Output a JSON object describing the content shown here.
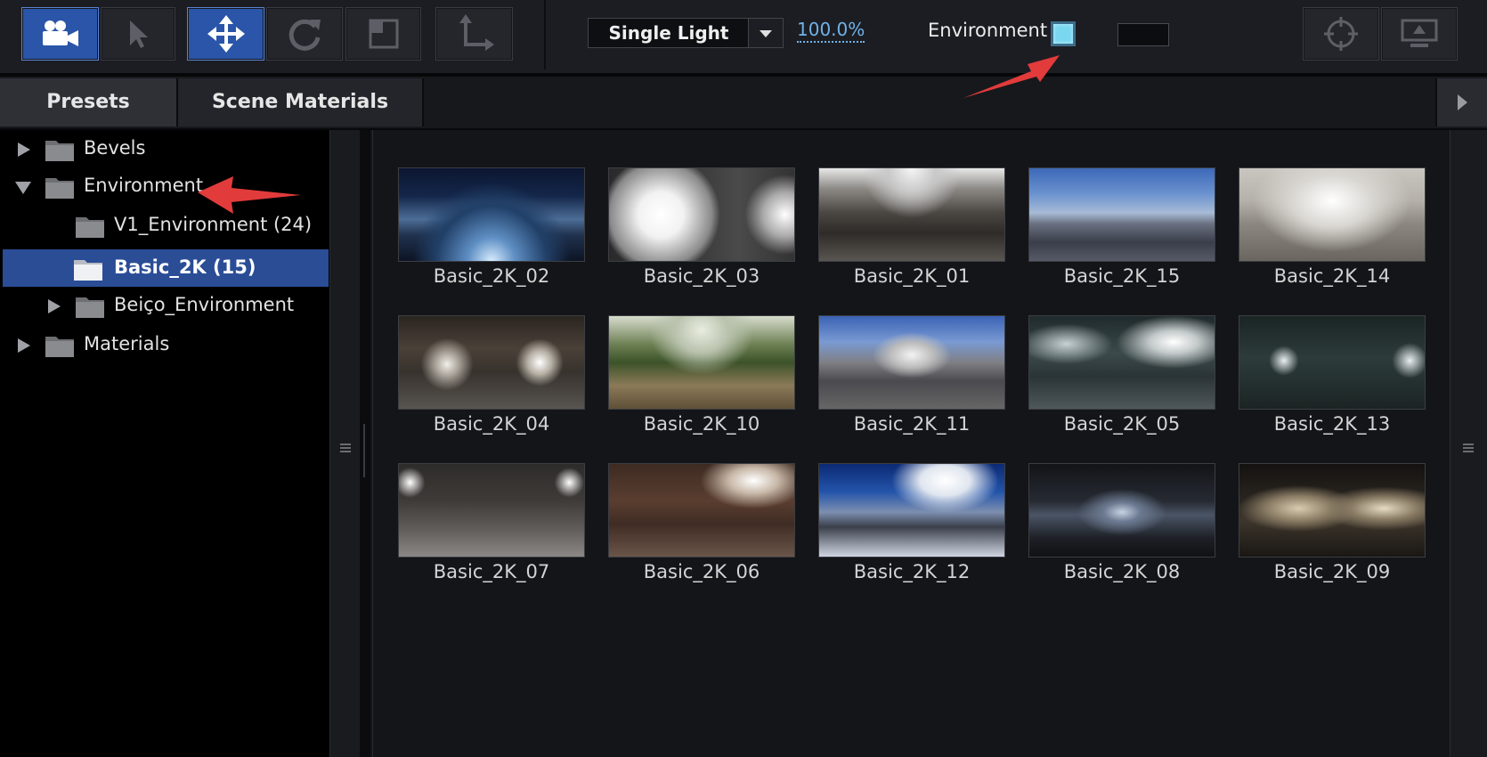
{
  "toolbar": {
    "tools": [
      {
        "name": "camera-tool-button",
        "icon": "video-camera-icon",
        "active": true
      },
      {
        "name": "select-tool-button",
        "icon": "pointer-arrow-icon",
        "active": false
      },
      {
        "name": "move-tool-button",
        "icon": "move-arrows-icon",
        "active": true
      },
      {
        "name": "rotate-tool-button",
        "icon": "rotate-icon",
        "active": false
      },
      {
        "name": "scale-tool-button",
        "icon": "scale-box-icon",
        "active": false
      },
      {
        "name": "axis-tool-button",
        "icon": "axis-arrows-icon",
        "active": false
      }
    ],
    "lighting_mode": "Single Light",
    "light_intensity": "100.0%",
    "environment_label": "Environment",
    "environment_color": "#79d7ef",
    "background_color": "#0c0d10",
    "right_buttons": [
      {
        "name": "target-button",
        "icon": "crosshair-icon"
      },
      {
        "name": "display-button",
        "icon": "monitor-icon"
      }
    ]
  },
  "tabs": [
    {
      "label": "Presets",
      "active": true
    },
    {
      "label": "Scene Materials",
      "active": false
    }
  ],
  "tree": [
    {
      "label": "Bevels",
      "level": 0,
      "expanded": false,
      "has_children": true,
      "selected": false
    },
    {
      "label": "Environment",
      "level": 0,
      "expanded": true,
      "has_children": true,
      "selected": false
    },
    {
      "label": "V1_Environment (24)",
      "level": 1,
      "expanded": false,
      "has_children": false,
      "selected": false
    },
    {
      "label": "Basic_2K (15)",
      "level": 1,
      "expanded": false,
      "has_children": false,
      "selected": true
    },
    {
      "label": "Beiço_Environment",
      "level": 1,
      "expanded": false,
      "has_children": true,
      "selected": false
    },
    {
      "label": "Materials",
      "level": 0,
      "expanded": false,
      "has_children": true,
      "selected": false
    }
  ],
  "thumbnails": [
    {
      "label": "Basic_2K_02",
      "scene": "city-night"
    },
    {
      "label": "Basic_2K_03",
      "scene": "studio-white"
    },
    {
      "label": "Basic_2K_01",
      "scene": "hall"
    },
    {
      "label": "Basic_2K_15",
      "scene": "city-day"
    },
    {
      "label": "Basic_2K_14",
      "scene": "bright-room"
    },
    {
      "label": "Basic_2K_04",
      "scene": "warehouse"
    },
    {
      "label": "Basic_2K_10",
      "scene": "greenhouse"
    },
    {
      "label": "Basic_2K_11",
      "scene": "plaza"
    },
    {
      "label": "Basic_2K_05",
      "scene": "garage-teal"
    },
    {
      "label": "Basic_2K_13",
      "scene": "dim-teal"
    },
    {
      "label": "Basic_2K_07",
      "scene": "parking"
    },
    {
      "label": "Basic_2K_06",
      "scene": "brown-hall"
    },
    {
      "label": "Basic_2K_12",
      "scene": "sky"
    },
    {
      "label": "Basic_2K_08",
      "scene": "dark-tunnel"
    },
    {
      "label": "Basic_2K_09",
      "scene": "dark-lit"
    }
  ]
}
